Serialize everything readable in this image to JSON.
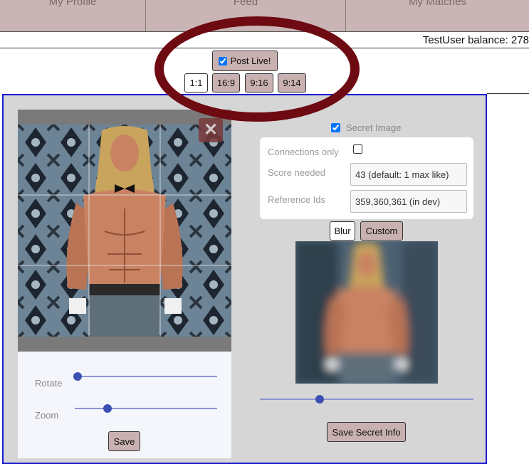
{
  "nav": {
    "tabs": [
      {
        "label": "My Profile"
      },
      {
        "label": "Feed"
      },
      {
        "label": "My Matches"
      }
    ]
  },
  "balance_text": "TestUser balance: 278",
  "post_live": {
    "label": "Post Live!",
    "checked": true
  },
  "aspect_ratios": [
    "1:1",
    "16:9",
    "9:16",
    "9:14"
  ],
  "selected_aspect": "1:1",
  "editor": {
    "rotate_label": "Rotate",
    "zoom_label": "Zoom",
    "rotate_value": 0.0,
    "zoom_value": 0.23,
    "save_label": "Save",
    "close_icon": "close-icon"
  },
  "secret": {
    "label": "Secret Image",
    "checked": true,
    "connections_only_label": "Connections only",
    "connections_only_checked": false,
    "score_label": "Score needed",
    "score_value": "43 (default: 1 max like)",
    "ref_label": "Reference Ids",
    "ref_value": "359,360,361 (in dev)",
    "blur_label": "Blur",
    "custom_label": "Custom",
    "blur_value": 0.28,
    "save_info_label": "Save Secret Info"
  },
  "colors": {
    "nav_bg": "#c9b5b5",
    "button_bg": "#c9b1b1",
    "panel_border": "#1a1ad0",
    "slider_thumb": "#3b4fb3",
    "annotation": "#6e0a12"
  }
}
